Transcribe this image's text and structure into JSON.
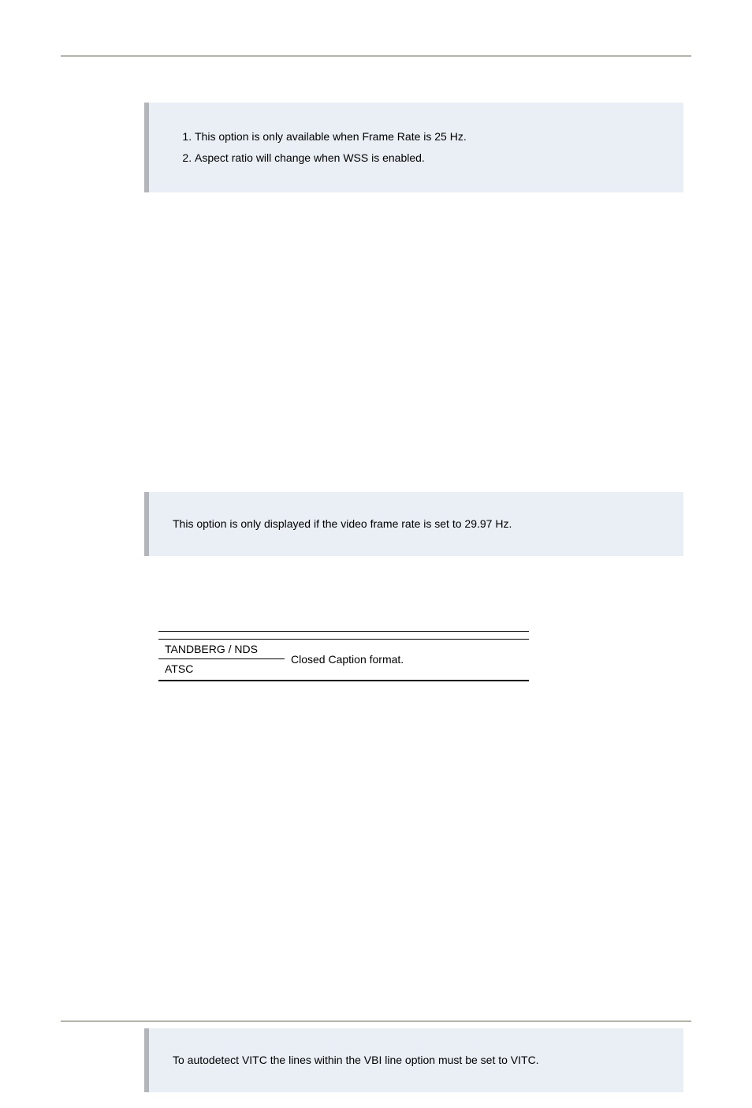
{
  "notes": {
    "note1_items": [
      "This option is only available when Frame Rate is 25 Hz.",
      "Aspect ratio will change when WSS is enabled."
    ],
    "note2_text": "This option is only displayed if the video frame rate is set to 29.97 Hz.",
    "note3_text": "To autodetect VITC the lines within the VBI line option must be set to VITC."
  },
  "table": {
    "row1_left": "TANDBERG / NDS",
    "row2_left": "ATSC",
    "right_text": "Closed Caption format."
  }
}
